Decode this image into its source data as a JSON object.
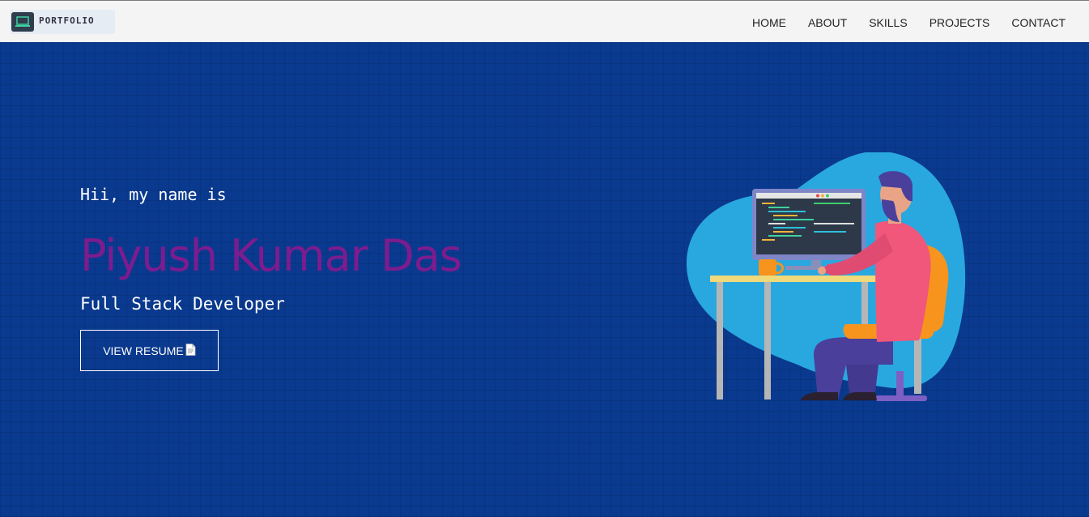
{
  "header": {
    "logo_text": "PORTFOLIO",
    "logo_icon": "laptop-icon"
  },
  "nav": {
    "items": [
      {
        "label": "HOME"
      },
      {
        "label": "ABOUT"
      },
      {
        "label": "SKILLS"
      },
      {
        "label": "PROJECTS"
      },
      {
        "label": "CONTACT"
      }
    ]
  },
  "hero": {
    "greeting": "Hii, my name is",
    "name": "Piyush Kumar Das",
    "role": "Full Stack Developer",
    "resume_label": "VIEW RESUME",
    "resume_icon": "document-icon",
    "illustration": "developer-at-desk-illustration"
  },
  "colors": {
    "background": "#0a3a8f",
    "navbar": "#f4f4f4",
    "name": "#7c1c8f",
    "blob": "#29a8e0",
    "shirt": "#f0577a",
    "chair": "#f7941d"
  }
}
